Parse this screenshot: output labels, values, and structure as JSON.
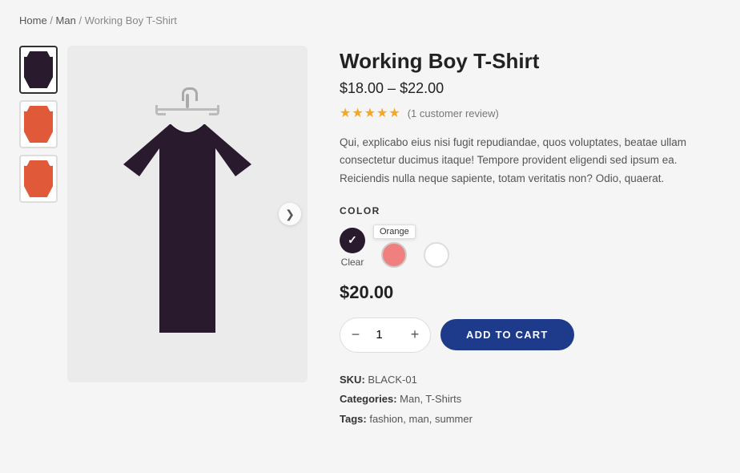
{
  "breadcrumb": {
    "items": [
      {
        "label": "Home",
        "href": "#"
      },
      {
        "label": "Man",
        "href": "#"
      },
      {
        "label": "Working Boy T-Shirt",
        "href": "#"
      }
    ],
    "separator": "/"
  },
  "product": {
    "title": "Working Boy T-Shirt",
    "price_range": "$18.00 – $22.00",
    "rating": {
      "stars": 5,
      "review_count": "(1 customer review)"
    },
    "description": "Qui, explicabo eius nisi fugit repudiandae, quos voluptates, beatae ullam consectetur ducimus itaque! Tempore provident eligendi sed ipsum ea. Reiciendis nulla neque sapiente, totam veritatis non? Odio, quaerat.",
    "color_label": "COLOR",
    "swatches": [
      {
        "id": "black",
        "color": "#2a1a2e",
        "label": "Clear",
        "selected": true
      },
      {
        "id": "orange",
        "color": "#f08080",
        "label": "Orange",
        "tooltip": "Orange",
        "hovered": true
      },
      {
        "id": "white",
        "color": "#ffffff",
        "label": "White",
        "selected": false
      }
    ],
    "clear_label": "Clear",
    "price": "$20.00",
    "quantity": 1,
    "qty_minus_label": "−",
    "qty_plus_label": "+",
    "add_to_cart_label": "ADD TO CART",
    "sku_label": "SKU:",
    "sku_value": "BLACK-01",
    "categories_label": "Categories:",
    "categories_value": "Man, T-Shirts",
    "tags_label": "Tags:",
    "tags_value": "fashion, man, summer",
    "thumbnails": [
      {
        "alt": "Black T-Shirt",
        "active": true,
        "color": "#2a1a2e"
      },
      {
        "alt": "Red T-Shirt",
        "active": false,
        "color": "#e05a3a"
      },
      {
        "alt": "Red T-Shirt 2",
        "active": false,
        "color": "#e05a3a"
      }
    ],
    "next_arrow": "❯"
  }
}
